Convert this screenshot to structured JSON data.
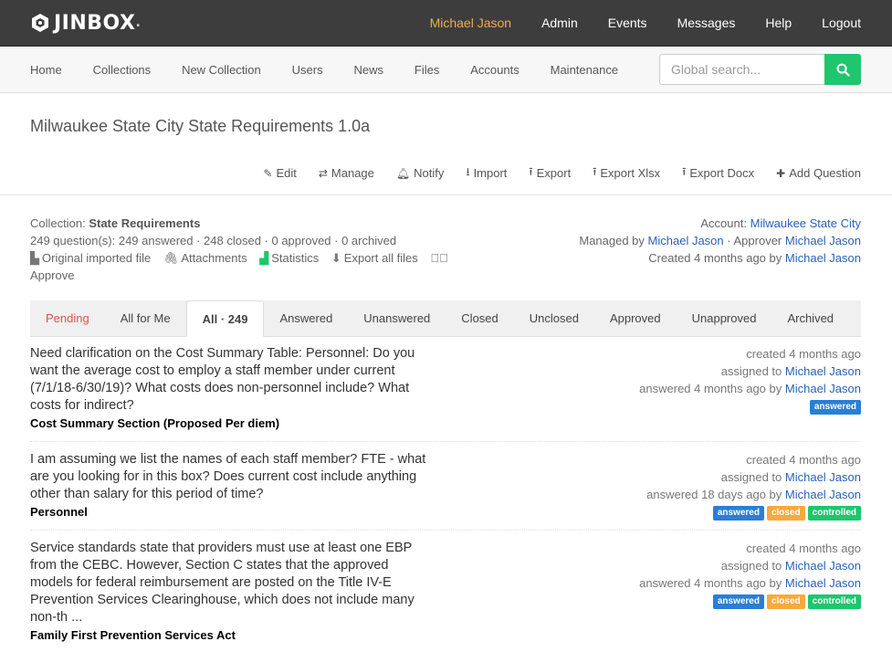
{
  "brand": {
    "name": "JINBOX",
    "suffix": "."
  },
  "topnav": {
    "user": "Michael Jason",
    "items": [
      "Admin",
      "Events",
      "Messages",
      "Help",
      "Logout"
    ]
  },
  "subnav": {
    "items": [
      "Home",
      "Collections",
      "New Collection",
      "Users",
      "News",
      "Files",
      "Accounts",
      "Maintenance"
    ],
    "search_placeholder": "Global search..."
  },
  "page": {
    "title": "Milwaukee State City State Requirements 1.0a",
    "actions": [
      "Edit",
      "Manage",
      "Notify",
      "Import",
      "Export",
      "Export Xlsx",
      "Export Docx",
      "Add Question"
    ]
  },
  "meta": {
    "collection_label": "Collection:",
    "collection_name": "State Requirements",
    "stats": "249 question(s): 249 answered · 248 closed · 0 approved · 0 archived",
    "links": [
      "Original imported file",
      "Attachments",
      "Statistics",
      "Export all files"
    ],
    "approve": "Approve",
    "account_label": "Account:",
    "account_name": "Milwaukee State City",
    "managed_by_label": "Managed by",
    "managed_by": "Michael Jason",
    "approver_label": "· Approver",
    "approver": "Michael Jason",
    "created_label": "Created 4 months ago by",
    "created_by": "Michael Jason"
  },
  "tabs": [
    "Pending",
    "All for Me",
    "All · 249",
    "Answered",
    "Unanswered",
    "Closed",
    "Unclosed",
    "Approved",
    "Unapproved",
    "Archived"
  ],
  "questions": [
    {
      "text": "Need clarification on the Cost Summary Table: Personnel: Do you want the average cost to employ a staff member under current (7/1/18-6/30/19)? What costs does non-personnel include? What costs for indirect?",
      "section": "Cost Summary Section (Proposed Per diem)",
      "created": "created 4 months ago",
      "assigned_label": "assigned to",
      "assigned_to": "Michael Jason",
      "answered_label": "answered 4 months ago by",
      "answered_by": "Michael Jason",
      "badges": [
        "answered"
      ]
    },
    {
      "text": "I am assuming we list the names of each staff member? FTE - what are you looking for in this box? Does current cost include anything other than salary for this period of time?",
      "section": "Personnel",
      "created": "created 4 months ago",
      "assigned_label": "assigned to",
      "assigned_to": "Michael Jason",
      "answered_label": "answered 18 days ago by",
      "answered_by": "Michael Jason",
      "badges": [
        "answered",
        "closed",
        "controlled"
      ]
    },
    {
      "text": "Service standards state that providers must use at least one EBP from the CEBC. However, Section C states that the approved models for federal reimbursement are posted on the Title IV-E Prevention Services Clearinghouse, which does not include many non-th ...",
      "section": "Family First Prevention Services Act",
      "created": "created 4 months ago",
      "assigned_label": "assigned to",
      "assigned_to": "Michael Jason",
      "answered_label": "answered 4 months ago by",
      "answered_by": "Michael Jason",
      "badges": [
        "answered",
        "closed",
        "controlled"
      ]
    }
  ]
}
